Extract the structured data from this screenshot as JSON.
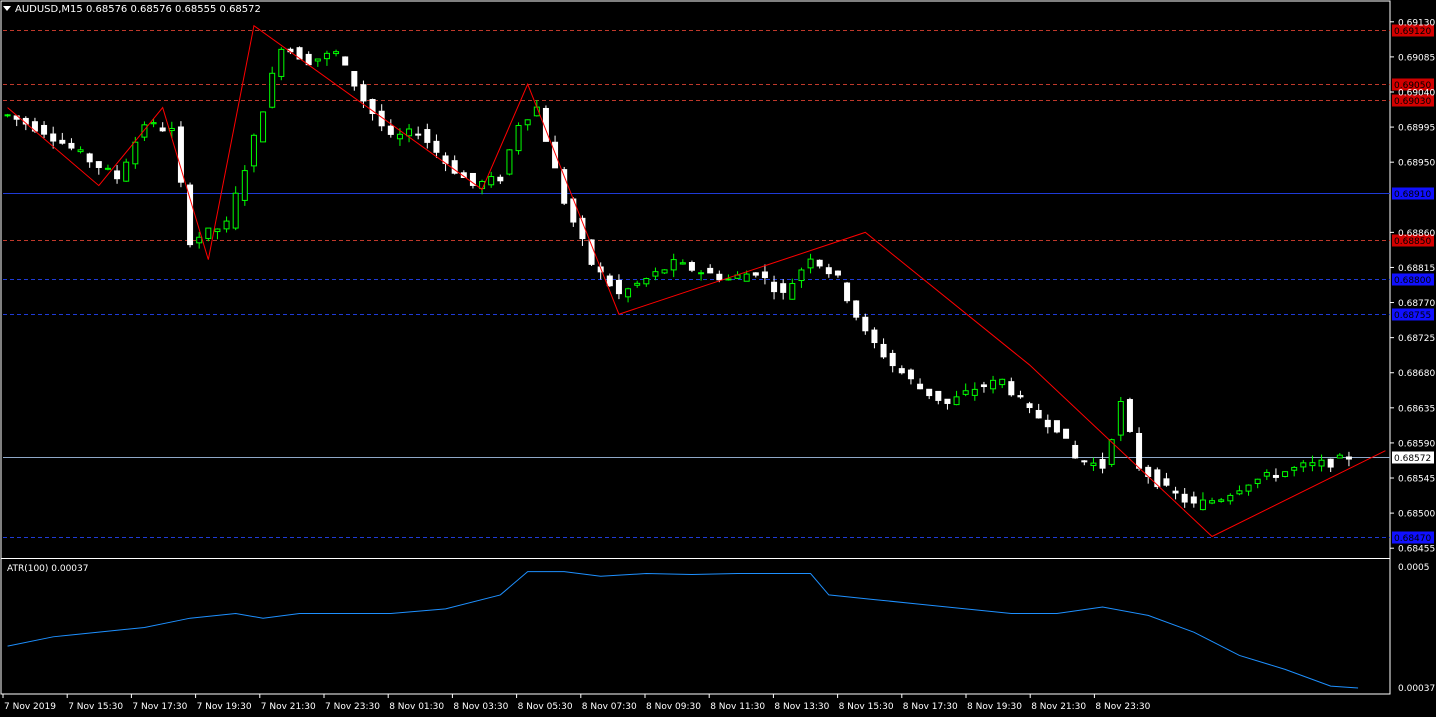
{
  "header": {
    "symbol_info": "AUDUSD,M15  0.68576 0.68576 0.68555 0.68572"
  },
  "indicator": {
    "label": "ATR(100) 0.00037",
    "axis_top": "0.0005",
    "axis_bottom": "0.00037"
  },
  "colors": {
    "bull": "#00ff00",
    "bear": "#ffffff",
    "zigzag": "#ff0000",
    "atr": "#1e90ff",
    "res_line": "#c0392b",
    "sup_line": "#1f3bd6",
    "axis": "#ffffff"
  },
  "chart_data": {
    "type": "candlestick",
    "symbol": "AUDUSD",
    "timeframe": "M15",
    "ylim": [
      0.68445,
      0.6914
    ],
    "y_ticks": [
      "0.69130",
      "0.69085",
      "0.69040",
      "0.68995",
      "0.68950",
      "0.68860",
      "0.68815",
      "0.68770",
      "0.68725",
      "0.68680",
      "0.68635",
      "0.68590",
      "0.68545",
      "0.68500",
      "0.68455"
    ],
    "x_ticks": [
      "7 Nov 2019",
      "7 Nov 15:30",
      "7 Nov 17:30",
      "7 Nov 19:30",
      "7 Nov 21:30",
      "7 Nov 23:30",
      "8 Nov 01:30",
      "8 Nov 03:30",
      "8 Nov 05:30",
      "8 Nov 07:30",
      "8 Nov 09:30",
      "8 Nov 11:30",
      "8 Nov 13:30",
      "8 Nov 15:30",
      "8 Nov 17:30",
      "8 Nov 19:30",
      "8 Nov 21:30",
      "8 Nov 23:30"
    ],
    "current_price": "0.68572",
    "levels": [
      {
        "price": "0.69120",
        "kind": "resistance",
        "style": "dashed"
      },
      {
        "price": "0.69050",
        "kind": "resistance",
        "style": "dashed"
      },
      {
        "price": "0.69030",
        "kind": "resistance",
        "style": "dashed"
      },
      {
        "price": "0.68910",
        "kind": "support",
        "style": "solid"
      },
      {
        "price": "0.68850",
        "kind": "resistance",
        "style": "dashed"
      },
      {
        "price": "0.68800",
        "kind": "support",
        "style": "dashed"
      },
      {
        "price": "0.68755",
        "kind": "support",
        "style": "dashed"
      },
      {
        "price": "0.68470",
        "kind": "support",
        "style": "dashed"
      }
    ],
    "close_path": [
      [
        0,
        0.6901
      ],
      [
        4,
        0.6899
      ],
      [
        8,
        0.6896
      ],
      [
        12,
        0.6893
      ],
      [
        15,
        0.69
      ],
      [
        18,
        0.6899
      ],
      [
        20,
        0.6885
      ],
      [
        24,
        0.6887
      ],
      [
        27,
        0.6898
      ],
      [
        30,
        0.691
      ],
      [
        33,
        0.6908
      ],
      [
        36,
        0.6909
      ],
      [
        39,
        0.6903
      ],
      [
        42,
        0.6898
      ],
      [
        45,
        0.6899
      ],
      [
        48,
        0.6895
      ],
      [
        51,
        0.6892
      ],
      [
        54,
        0.6893
      ],
      [
        56,
        0.69
      ],
      [
        58,
        0.6902
      ],
      [
        61,
        0.689
      ],
      [
        64,
        0.6882
      ],
      [
        67,
        0.6878
      ],
      [
        70,
        0.688
      ],
      [
        73,
        0.6882
      ],
      [
        76,
        0.6881
      ],
      [
        79,
        0.688
      ],
      [
        82,
        0.6881
      ],
      [
        85,
        0.6878
      ],
      [
        88,
        0.6883
      ],
      [
        91,
        0.688
      ],
      [
        94,
        0.6873
      ],
      [
        97,
        0.6869
      ],
      [
        100,
        0.6866
      ],
      [
        103,
        0.6864
      ],
      [
        106,
        0.6866
      ],
      [
        109,
        0.6867
      ],
      [
        112,
        0.6863
      ],
      [
        115,
        0.6861
      ],
      [
        117,
        0.6857
      ],
      [
        120,
        0.6856
      ],
      [
        122,
        0.6864
      ],
      [
        124,
        0.6856
      ],
      [
        127,
        0.6853
      ],
      [
        130,
        0.6851
      ],
      [
        133,
        0.6852
      ],
      [
        136,
        0.6854
      ],
      [
        139,
        0.6855
      ],
      [
        142,
        0.6856
      ],
      [
        145,
        0.68565
      ],
      [
        147,
        0.68572
      ]
    ],
    "zigzag": [
      [
        0,
        0.6902
      ],
      [
        10,
        0.6892
      ],
      [
        17,
        0.6902
      ],
      [
        22,
        0.68825
      ],
      [
        27,
        0.69125
      ],
      [
        52,
        0.68915
      ],
      [
        57,
        0.6905
      ],
      [
        67,
        0.68755
      ],
      [
        94,
        0.6886
      ],
      [
        112,
        0.6869
      ],
      [
        132,
        0.6847
      ],
      [
        151,
        0.6858
      ]
    ],
    "atr_path": [
      [
        0,
        0.000415
      ],
      [
        5,
        0.000425
      ],
      [
        10,
        0.00043
      ],
      [
        15,
        0.000435
      ],
      [
        20,
        0.000445
      ],
      [
        25,
        0.00045
      ],
      [
        28,
        0.000445
      ],
      [
        32,
        0.00045
      ],
      [
        36,
        0.00045
      ],
      [
        42,
        0.00045
      ],
      [
        48,
        0.000455
      ],
      [
        54,
        0.00047
      ],
      [
        57,
        0.000495
      ],
      [
        61,
        0.000495
      ],
      [
        65,
        0.00049
      ],
      [
        70,
        0.000493
      ],
      [
        75,
        0.000492
      ],
      [
        80,
        0.000493
      ],
      [
        85,
        0.000493
      ],
      [
        88,
        0.000493
      ],
      [
        90,
        0.00047
      ],
      [
        95,
        0.000465
      ],
      [
        100,
        0.00046
      ],
      [
        105,
        0.000455
      ],
      [
        110,
        0.00045
      ],
      [
        115,
        0.00045
      ],
      [
        120,
        0.000457
      ],
      [
        125,
        0.000448
      ],
      [
        130,
        0.00043
      ],
      [
        135,
        0.000405
      ],
      [
        140,
        0.00039
      ],
      [
        145,
        0.000372
      ],
      [
        148,
        0.00037
      ]
    ],
    "atr_ylim": [
      0.00037,
      0.0005
    ]
  }
}
